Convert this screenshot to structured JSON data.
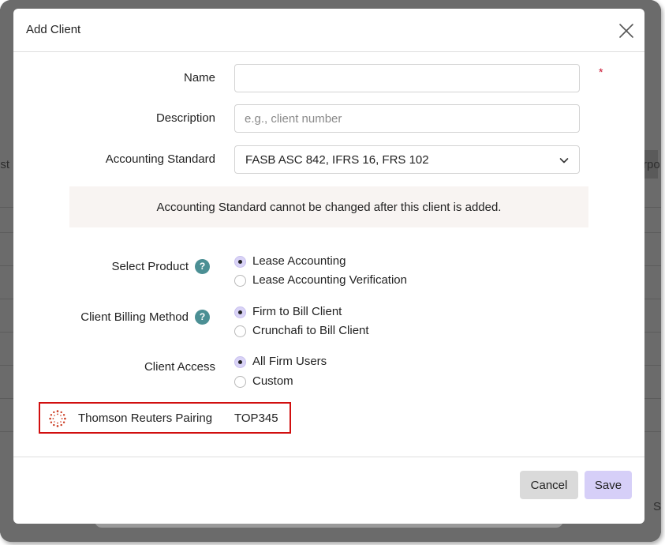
{
  "background": {
    "fragments": [
      "est",
      "rpo",
      "S"
    ]
  },
  "modal": {
    "title": "Add Client",
    "fields": {
      "name_label": "Name",
      "name_value": "",
      "description_label": "Description",
      "description_placeholder": "e.g., client number",
      "accounting_standard_label": "Accounting Standard",
      "accounting_standard_value": "FASB ASC 842, IFRS 16, FRS 102"
    },
    "required_marker": "*",
    "notice": "Accounting Standard cannot be changed after this client is added.",
    "select_product": {
      "label": "Select Product",
      "help": "?",
      "options": [
        {
          "label": "Lease Accounting",
          "selected": true
        },
        {
          "label": "Lease Accounting Verification",
          "selected": false
        }
      ]
    },
    "billing_method": {
      "label": "Client Billing Method",
      "help": "?",
      "options": [
        {
          "label": "Firm to Bill Client",
          "selected": true
        },
        {
          "label": "Crunchafi to Bill Client",
          "selected": false
        }
      ]
    },
    "client_access": {
      "label": "Client Access",
      "options": [
        {
          "label": "All Firm Users",
          "selected": true
        },
        {
          "label": "Custom",
          "selected": false
        }
      ]
    },
    "pairing": {
      "label": "Thomson Reuters Pairing",
      "value": "TOP345",
      "icon": "thomson-reuters-logo"
    },
    "buttons": {
      "cancel": "Cancel",
      "save": "Save"
    }
  },
  "colors": {
    "accent_radio": "#d9d3f6",
    "save_button": "#d6cff8",
    "help_icon": "#4b8f94",
    "highlight_border": "#d10f0f",
    "notice_bg": "#f8f4f2",
    "required": "#c8102e"
  }
}
